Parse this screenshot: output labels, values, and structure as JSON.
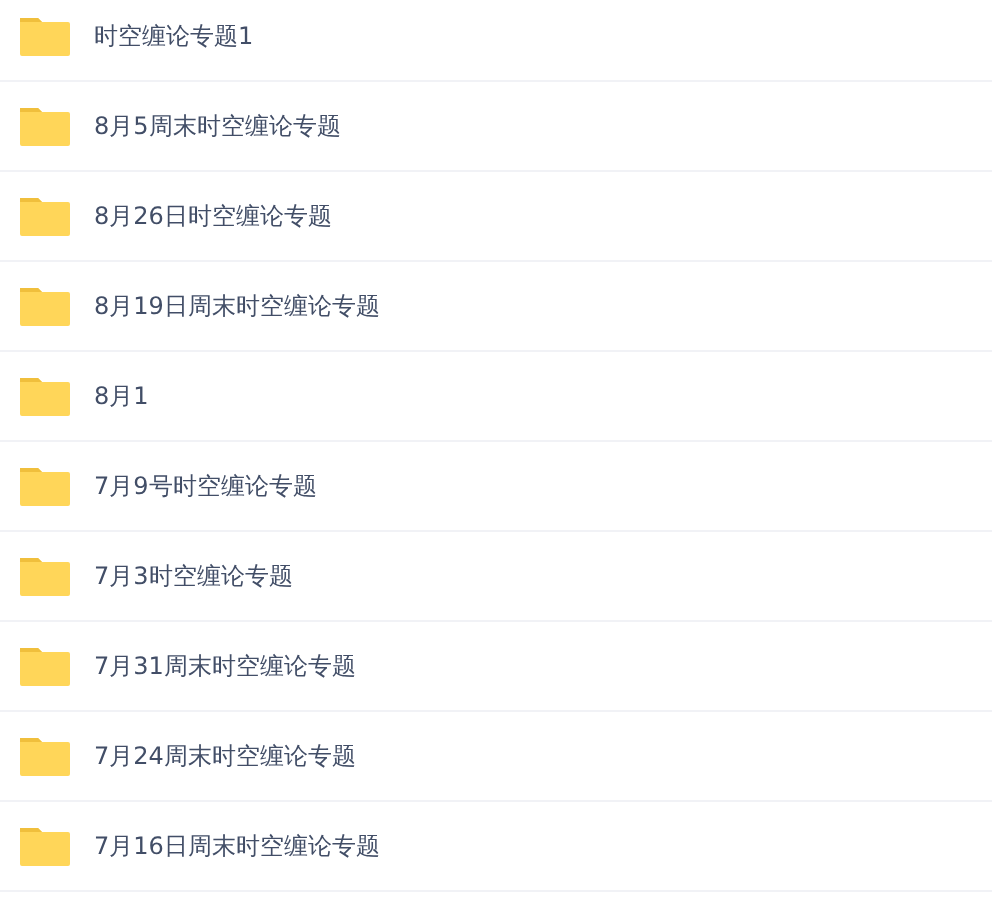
{
  "folders": [
    {
      "name": "时空缠论专题1"
    },
    {
      "name": "8月5周末时空缠论专题"
    },
    {
      "name": "8月26日时空缠论专题"
    },
    {
      "name": "8月19日周末时空缠论专题"
    },
    {
      "name": "8月1"
    },
    {
      "name": "7月9号时空缠论专题"
    },
    {
      "name": "7月3时空缠论专题"
    },
    {
      "name": "7月31周末时空缠论专题"
    },
    {
      "name": "7月24周末时空缠论专题"
    },
    {
      "name": "7月16日周末时空缠论专题"
    }
  ]
}
